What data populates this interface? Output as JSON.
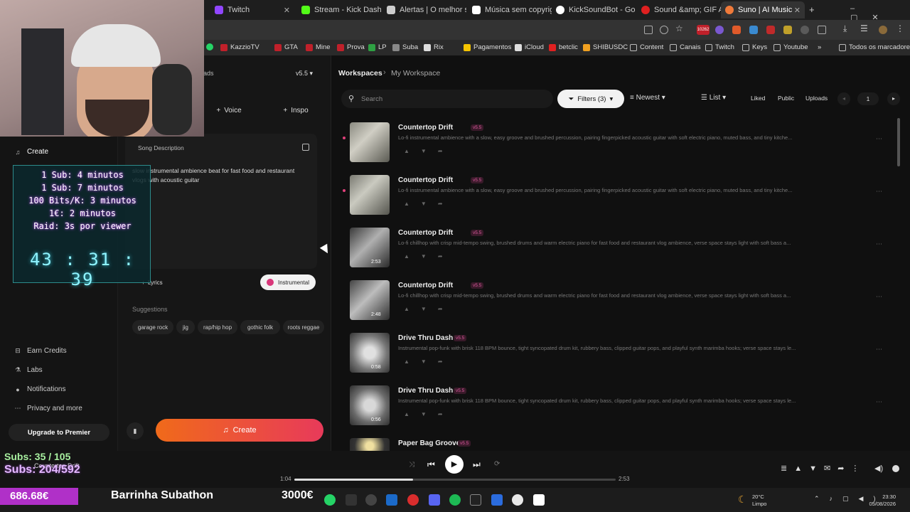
{
  "browser": {
    "tabs": [
      {
        "label": "Twitch",
        "color": "#9146ff"
      },
      {
        "label": "Stream - Kick Dashb",
        "color": "#53fc18"
      },
      {
        "label": "Alertas | O melhor s",
        "color": "#cccccc"
      },
      {
        "label": "Música sem copyrig",
        "color": "#ffffff"
      },
      {
        "label": "KickSoundBot - Goo",
        "color": "#ffffff"
      },
      {
        "label": "Sound &amp; GIF Al",
        "color": "#e02020"
      },
      {
        "label": "Suno | AI Music",
        "color": "#f07a3a"
      }
    ],
    "new_tab": "+",
    "bookmarks": [
      "KazzioTV",
      "GTA",
      "Mine",
      "Prova",
      "LP",
      "Suba",
      "Rix",
      "Pagamentos",
      "iCloud",
      "betclic",
      "SHIBUSDC",
      "Content",
      "Canais",
      "Twitch",
      "Keys",
      "Youtube"
    ],
    "bookmarks_more": "»",
    "all_bookmarks": "Todos os marcadores",
    "notif_badge": "10262"
  },
  "sidebar": {
    "create": "Create",
    "bottom_items": [
      {
        "label": "Earn Credits",
        "icon": "earn-icon"
      },
      {
        "label": "Labs",
        "icon": "labs-icon"
      },
      {
        "label": "Notifications",
        "icon": "bell-icon"
      },
      {
        "label": "Privacy and more",
        "icon": "dots-icon"
      }
    ],
    "upgrade": "Upgrade to Premier"
  },
  "create_panel": {
    "top_tab": "ads",
    "version": "v5.5",
    "voice": "Voice",
    "inspo": "Inspo",
    "song_description_label": "Song Description",
    "song_description": "slow instrumental ambience beat for fast food and restaurant vlogs with acoustic guitar",
    "lyrics": "Lyrics",
    "instrumental": "Instrumental",
    "suggestions_label": "Suggestions",
    "suggestions": [
      "garage rock",
      "jig",
      "rap/hip hop",
      "gothic folk",
      "roots reggae"
    ],
    "create_button": "Create"
  },
  "library": {
    "breadcrumb_root": "Workspaces",
    "breadcrumb_sep": "›",
    "breadcrumb_current": "My Workspace",
    "search_placeholder": "Search",
    "filters": "Filters (3)",
    "sort": "Newest",
    "view": "List",
    "liked": "Liked",
    "public": "Public",
    "uploads": "Uploads",
    "page": "1",
    "songs": [
      {
        "title": "Countertop Drift",
        "version": "v5.5",
        "duration": "",
        "desc": "Lo-fi instrumental ambience with a slow, easy groove and brushed percussion, pairing fingerpicked acoustic guitar with soft electric piano, muted bass, and tiny kitche..."
      },
      {
        "title": "Countertop Drift",
        "version": "v5.5",
        "duration": "",
        "desc": "Lo-fi instrumental ambience with a slow, easy groove and brushed percussion, pairing fingerpicked acoustic guitar with soft electric piano, muted bass, and tiny kitche..."
      },
      {
        "title": "Countertop Drift",
        "version": "v5.5",
        "duration": "2:53",
        "desc": "Lo-fi chillhop with crisp mid-tempo swing, brushed drums and warm electric piano for fast food and restaurant vlog ambience, verse space stays light with soft bass a..."
      },
      {
        "title": "Countertop Drift",
        "version": "v5.5",
        "duration": "2:48",
        "desc": "Lo-fi chillhop with crisp mid-tempo swing, brushed drums and warm electric piano for fast food and restaurant vlog ambience, verse space stays light with soft bass a..."
      },
      {
        "title": "Drive Thru Dash",
        "version": "v5.5",
        "duration": "0:58",
        "desc": "Instrumental pop-funk with brisk 118 BPM bounce, tight syncopated drum kit, rubbery bass, clipped guitar pops, and playful synth marimba hooks; verse space stays le..."
      },
      {
        "title": "Drive Thru Dash",
        "version": "v5.5",
        "duration": "0:56",
        "desc": "Instrumental pop-funk with brisk 118 BPM bounce, tight syncopated drum kit, rubbery bass, clipped guitar pops, and playful synth marimba hooks; verse space stays le..."
      },
      {
        "title": "Paper Bag Groove",
        "version": "v5.5",
        "duration": "",
        "desc": ""
      }
    ]
  },
  "player": {
    "track": "Countertop Drift",
    "current_time": "1:04",
    "total_time": "2:53",
    "progress": 0.37
  },
  "overlay": {
    "subathon_lines": [
      "1 Sub: 4 minutos",
      "1 Sub: 7 minutos",
      "100 Bits/K: 3 minutos",
      "1€: 2 minutos",
      "Raid: 3s por viewer"
    ],
    "timer": "43 : 31 : 39",
    "subs_goal": "Subs: 35 / 105",
    "subs_total": "Subs: 204/592",
    "money": "686.68€",
    "bar_label": "Barrinha Subathon",
    "bar_goal": "3000€"
  },
  "taskbar": {
    "weather_temp": "20°C",
    "weather_desc": "Limpo",
    "time": "23:30",
    "date": "05/08/2026"
  }
}
